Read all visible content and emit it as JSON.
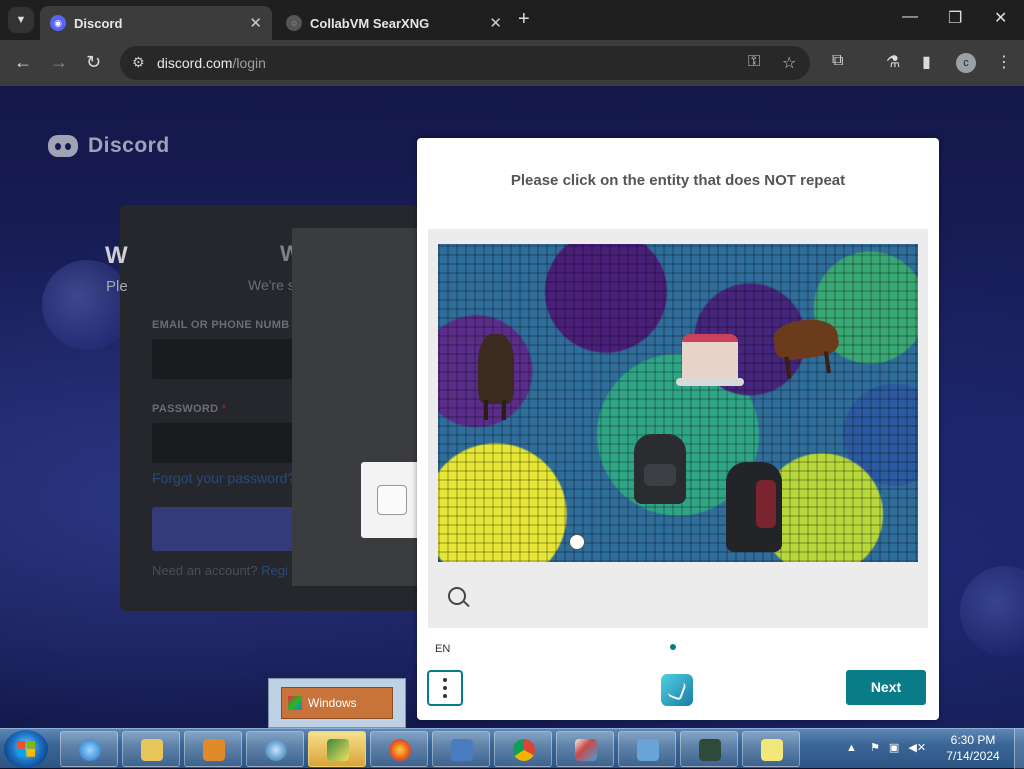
{
  "browser": {
    "tabs": [
      {
        "title": "Discord",
        "favicon": "discord-icon",
        "active": true
      },
      {
        "title": "CollabVM SearXNG",
        "favicon": "searxng-icon",
        "active": false
      }
    ],
    "new_tab_symbol": "+",
    "url_host": "discord.com",
    "url_path": "/login",
    "profile_initial": "c"
  },
  "discord": {
    "brand": "Discord",
    "welcome_title_fragment": "W",
    "welcome_sub_fragment": "We're s",
    "email_label": "EMAIL OR PHONE NUMB",
    "password_label": "PASSWORD",
    "required_mark": "*",
    "forgot_link": "Forgot your password?",
    "need_account": "Need an account?",
    "register_fragment": "Regi",
    "modal_title_fragment": "W",
    "modal_sub_fragment": "Ple"
  },
  "captcha": {
    "prompt": "Please click on the entity that does NOT repeat",
    "language": "EN",
    "next_label": "Next",
    "objects": [
      "horse",
      "horse",
      "birthday-cake",
      "backpack",
      "backpack"
    ],
    "accent_color": "#0a7c88"
  },
  "popup": {
    "button_label": "Windows"
  },
  "taskbar": {
    "time": "6:30 PM",
    "date": "7/14/2024",
    "apps": [
      "internet-explorer-icon",
      "file-explorer-icon",
      "media-player-icon",
      "network-globe-icon",
      "app-active-icon",
      "firefox-icon",
      "remote-desktop-icon",
      "chrome-icon",
      "paint-icon",
      "control-panel-icon",
      "system-monitor-icon",
      "sticky-notes-icon"
    ]
  }
}
